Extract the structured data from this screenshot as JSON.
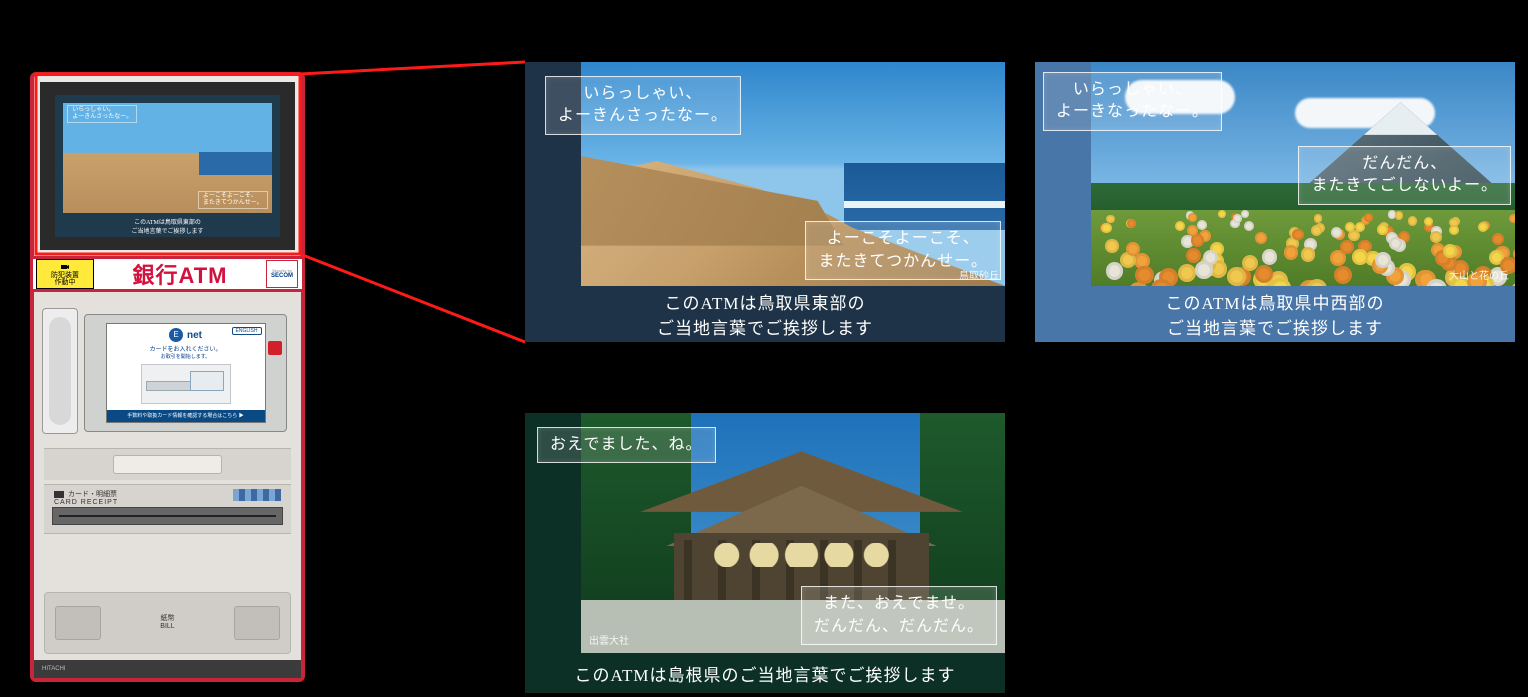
{
  "atm": {
    "security_sticker_l1": "防犯装置",
    "security_sticker_l2": "作動中",
    "sign_title": "銀行ATM",
    "secom_top": "Security by",
    "secom_name": "SECOM",
    "lcd_brand": "net",
    "lcd_english": "ENGLISH",
    "lcd_msg_l1": "カードをお入れください。",
    "lcd_msg_l2": "お取引を開始します。",
    "lcd_footer": "手数料や取扱カード情報を確認する場合はこちら ▶",
    "receipt_label_jp": "カード・明細票",
    "receipt_label_en": "CARD   RECEIPT",
    "bill_label_jp": "紙幣",
    "bill_label_en": "BILL",
    "vendor": "HITACHI",
    "mini_greet_l1": "いらっしゃい。",
    "mini_greet_l2": "よーきんさったなー。",
    "mini_greet2_l1": "よーこそよーこそ、",
    "mini_greet2_l2": "またきてつかんせー。",
    "mini_caption_l1": "このATMは鳥取県東部の",
    "mini_caption_l2": "ご当地言葉でご挨拶します"
  },
  "panels": {
    "p1": {
      "greet_l1": "いらっしゃい、",
      "greet_l2": "よーきんさったなー。",
      "greet2_l1": "よーこそよーこそ、",
      "greet2_l2": "またきてつかんせー。",
      "caption_l1": "このATMは鳥取県東部の",
      "caption_l2": "ご当地言葉でご挨拶します",
      "photo_label": "鳥取砂丘"
    },
    "p2": {
      "greet_l1": "いらっしゃい、",
      "greet_l2": "よーきなったなー。",
      "greet2_l1": "だんだん、",
      "greet2_l2": "またきてごしないよー。",
      "caption_l1": "このATMは鳥取県中西部の",
      "caption_l2": "ご当地言葉でご挨拶します",
      "photo_label": "大山と花の丘"
    },
    "p3": {
      "greet_l1": "おえでました、ね。",
      "greet2_l1": "また、おえでませ。",
      "greet2_l2": "だんだん、だんだん。",
      "caption_l1": "このATMは島根県のご当地言葉でご挨拶します",
      "photo_label": "出雲大社"
    }
  }
}
